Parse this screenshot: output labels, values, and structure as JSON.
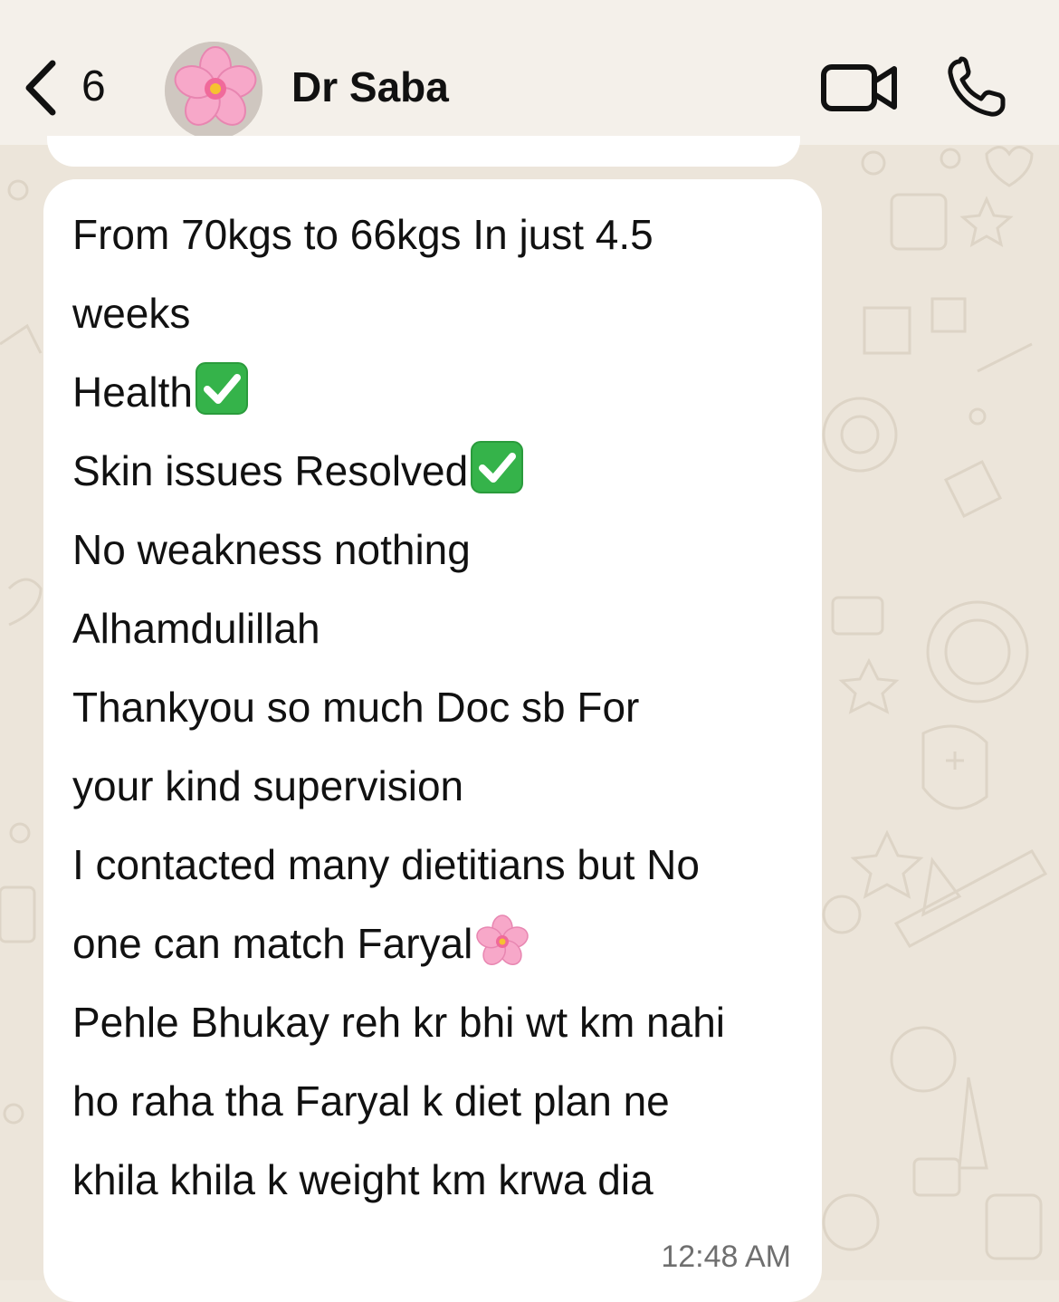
{
  "header": {
    "back_count": "6",
    "contact_name": "Dr Saba",
    "avatar_icon": "cherry-blossom-icon",
    "video_icon": "video-camera-icon",
    "call_icon": "phone-icon"
  },
  "message": {
    "lines": [
      "From 70kgs to 66kgs In just 4.5",
      "weeks",
      "Health",
      "Skin issues Resolved",
      "No weakness nothing",
      "Alhamdulillah",
      "Thankyou so much Doc sb For",
      "your kind supervision",
      "I contacted many dietitians but No",
      "one can match Faryal",
      "Pehle Bhukay reh kr bhi wt km nahi",
      "ho raha tha Faryal k diet plan ne",
      "khila khila k weight km krwa dia"
    ],
    "timestamp": "12:48 AM"
  },
  "colors": {
    "header_bg": "#f4f0ea",
    "wallpaper": "#ece5da",
    "bubble": "#ffffff",
    "check_green": "#35b34a",
    "blossom_pink": "#f5a6c8"
  }
}
